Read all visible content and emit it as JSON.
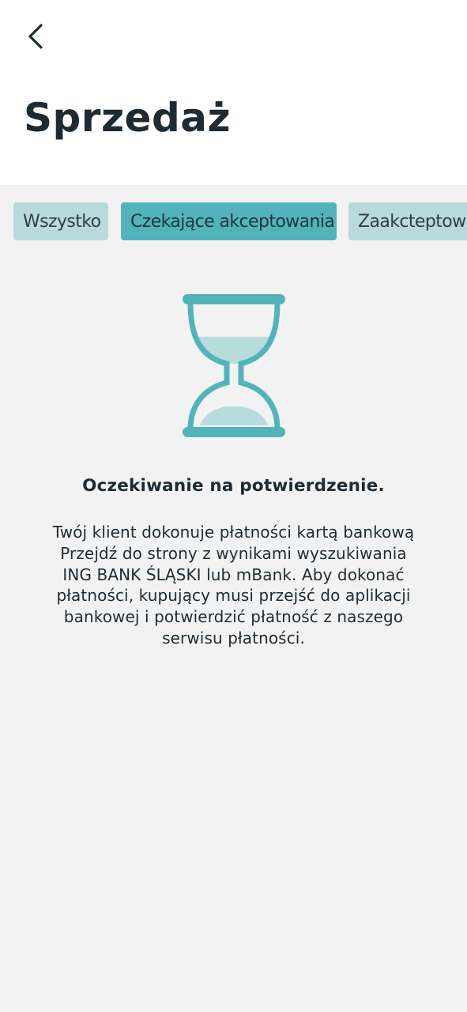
{
  "header": {
    "back_icon": "chevron-left-icon",
    "title": "Sprzedaż"
  },
  "tabs": [
    {
      "label": "Wszystko",
      "active": false
    },
    {
      "label": "Czekające akceptowania",
      "active": true
    },
    {
      "label": "Zaakcteptowa",
      "active": false
    }
  ],
  "empty_state": {
    "icon": "hourglass-icon",
    "title": "Oczekiwanie na potwierdzenie.",
    "description_lines": [
      "Twój klient dokonuje płatności kartą bankową",
      "Przejdź do strony z wynikami wyszukiwania",
      "ING BANK ŚLĄSKI lub mBank. Aby dokonać",
      "płatności, kupujący musi przejść do aplikacji",
      "bankowej i potwierdzić płatność z naszego",
      "serwisu płatności."
    ]
  },
  "colors": {
    "accent": "#52b4ba",
    "accent_light": "#b9dadd",
    "hourglass_sand": "#b8dcdc",
    "text_dark": "#1f2b33",
    "background": "#f2f2f2",
    "header_background": "#ffffff"
  }
}
